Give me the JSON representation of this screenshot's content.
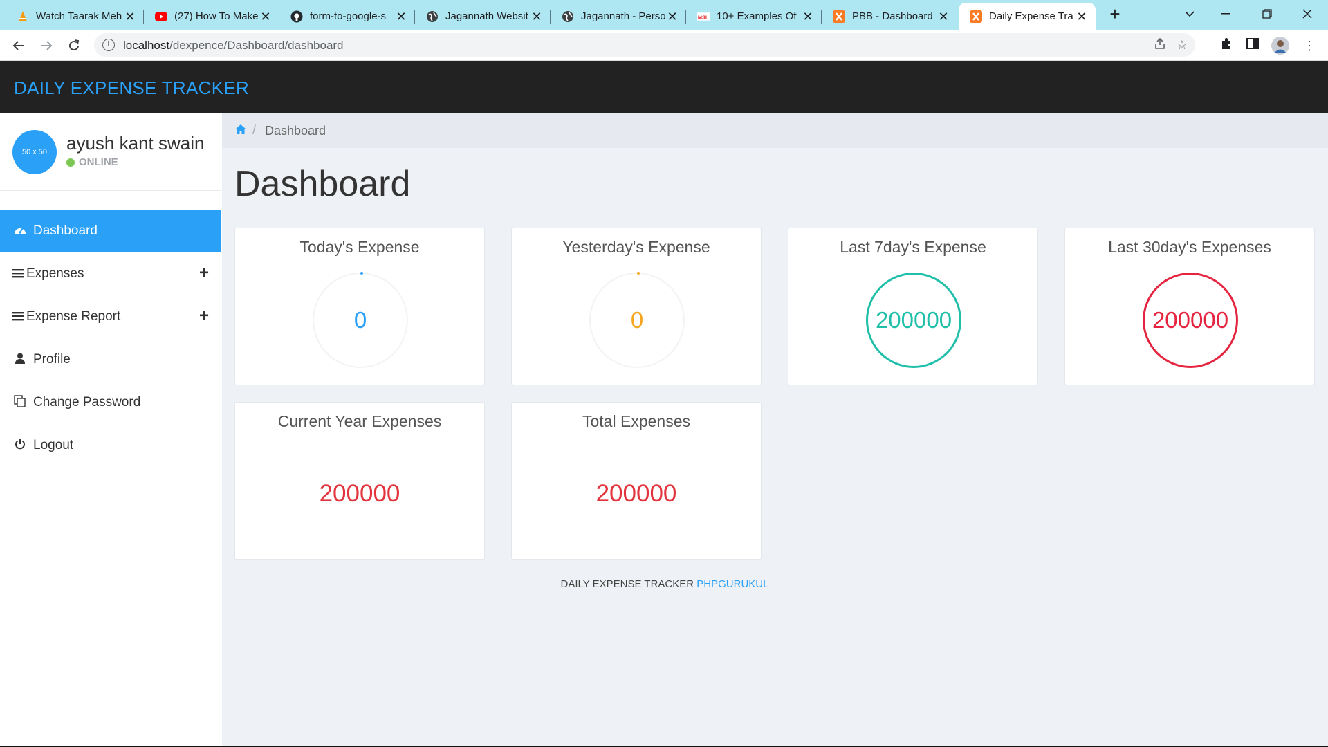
{
  "browser": {
    "tabs": [
      {
        "title": "Watch Taarak Meh",
        "icon": "vlc-cone-icon"
      },
      {
        "title": "(27) How To Make",
        "icon": "youtube-icon"
      },
      {
        "title": "form-to-google-s",
        "icon": "github-icon"
      },
      {
        "title": "Jagannath Websit",
        "icon": "globe-icon"
      },
      {
        "title": "Jagannath - Perso",
        "icon": "globe-icon"
      },
      {
        "title": "10+ Examples Of",
        "icon": "msi-icon"
      },
      {
        "title": "PBB - Dashboard",
        "icon": "xampp-icon"
      },
      {
        "title": "Daily Expense Tra",
        "icon": "xampp-icon"
      }
    ],
    "active_tab": 7,
    "url_host": "localhost",
    "url_path": "/dexpence/Dashboard/dashboard"
  },
  "app": {
    "title": "DAILY EXPENSE TRACKER"
  },
  "user": {
    "avatar_text": "50 x 50",
    "name": "ayush kant swain",
    "status": "ONLINE"
  },
  "menu": [
    {
      "label": "Dashboard",
      "icon": "dashboard-icon",
      "active": true
    },
    {
      "label": "Expenses",
      "icon": "bars-icon",
      "expandable": true
    },
    {
      "label": "Expense Report",
      "icon": "bars-icon",
      "expandable": true
    },
    {
      "label": "Profile",
      "icon": "user-icon"
    },
    {
      "label": "Change Password",
      "icon": "copy-icon"
    },
    {
      "label": "Logout",
      "icon": "power-icon"
    }
  ],
  "breadcrumb": {
    "current": "Dashboard"
  },
  "page": {
    "title": "Dashboard"
  },
  "cards": [
    {
      "title": "Today's Expense",
      "value": "0",
      "color": "#2aa0f7"
    },
    {
      "title": "Yesterday's Expense",
      "value": "0",
      "color": "#f5a623"
    },
    {
      "title": "Last 7day's Expense",
      "value": "200000",
      "color": "#1fbfa9"
    },
    {
      "title": "Last 30day's Expenses",
      "value": "200000",
      "color": "#e5243f"
    },
    {
      "title": "Current Year Expenses",
      "value": "200000",
      "color": "#e2343d"
    },
    {
      "title": "Total Expenses",
      "value": "200000",
      "color": "#e2343d"
    }
  ],
  "footer": {
    "text": "DAILY EXPENSE TRACKER",
    "link": "PHPGURUKUL"
  }
}
